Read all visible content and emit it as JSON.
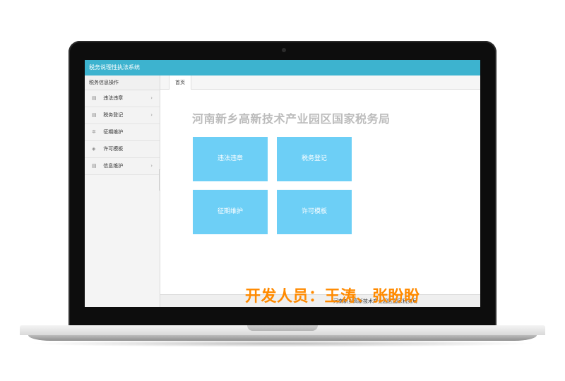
{
  "window": {
    "title": "税务说理性执法系统"
  },
  "sidebar": {
    "header": "税务信息操作",
    "items": [
      {
        "label": "违法违章",
        "icon": "document-icon",
        "has_arrow": true
      },
      {
        "label": "税务登记",
        "icon": "document-icon",
        "has_arrow": true
      },
      {
        "label": "征期维护",
        "icon": "gear-icon",
        "has_arrow": false
      },
      {
        "label": "许可模板",
        "icon": "tag-icon",
        "has_arrow": false
      },
      {
        "label": "信息维护",
        "icon": "document-icon",
        "has_arrow": true
      }
    ]
  },
  "tabs": [
    {
      "label": "首页"
    }
  ],
  "main": {
    "title": "河南新乡高新技术产业园区国家税务局",
    "tiles": [
      {
        "label": "违法违章"
      },
      {
        "label": "税务登记"
      },
      {
        "label": "征期维护"
      },
      {
        "label": "许可模板"
      }
    ]
  },
  "footer": {
    "text": "河南新乡高新技术产业园区国家税务局"
  },
  "overlay": {
    "developers": "开发人员：王涛、张盼盼"
  },
  "colors": {
    "titlebar": "#3db3cf",
    "tile": "#6dcff6",
    "overlay_text": "#ff8a00",
    "org_title": "#bcbcbc"
  }
}
